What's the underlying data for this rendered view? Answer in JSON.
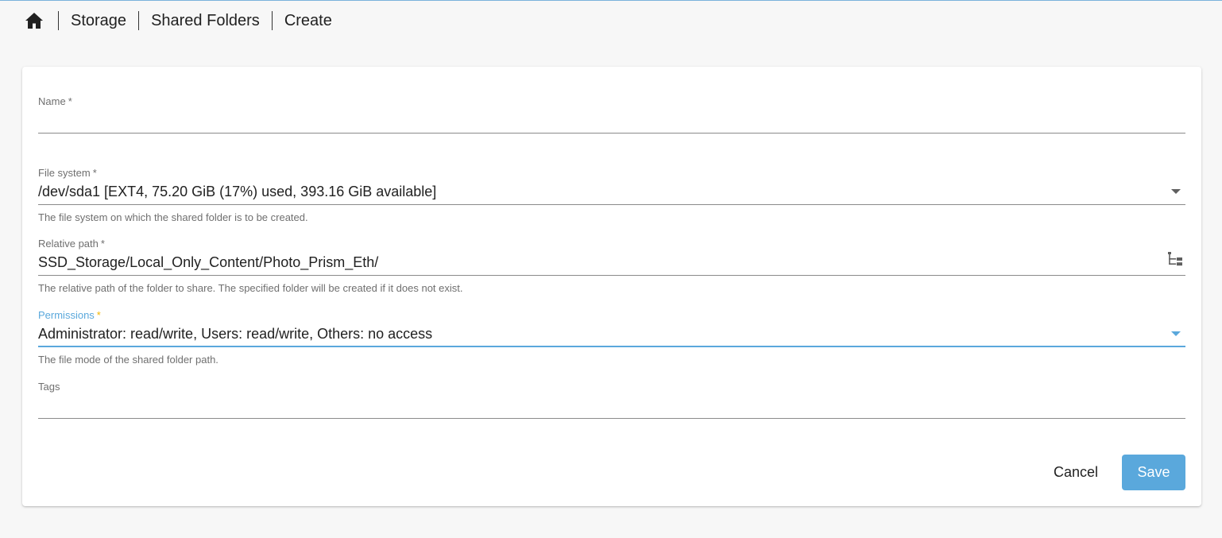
{
  "breadcrumb": {
    "home_icon": "home-icon",
    "items": [
      "Storage",
      "Shared Folders",
      "Create"
    ]
  },
  "form": {
    "name": {
      "label": "Name",
      "required_mark": "*",
      "value": ""
    },
    "file_system": {
      "label": "File system",
      "required_mark": "*",
      "value": "/dev/sda1 [EXT4, 75.20 GiB (17%) used, 393.16 GiB available]",
      "hint": "The file system on which the shared folder is to be created."
    },
    "relative_path": {
      "label": "Relative path",
      "required_mark": "*",
      "value": "SSD_Storage/Local_Only_Content/Photo_Prism_Eth/",
      "hint": "The relative path of the folder to share. The specified folder will be created if it does not exist.",
      "icon": "folder-tree-icon"
    },
    "permissions": {
      "label": "Permissions",
      "required_mark": "*",
      "value": "Administrator: read/write, Users: read/write, Others: no access",
      "hint": "The file mode of the shared folder path."
    },
    "tags": {
      "label": "Tags",
      "value": ""
    }
  },
  "actions": {
    "cancel_label": "Cancel",
    "save_label": "Save"
  },
  "colors": {
    "accent": "#5aa8dc",
    "required_active": "#f2b705",
    "background": "#f7f7f7",
    "card": "#ffffff"
  }
}
